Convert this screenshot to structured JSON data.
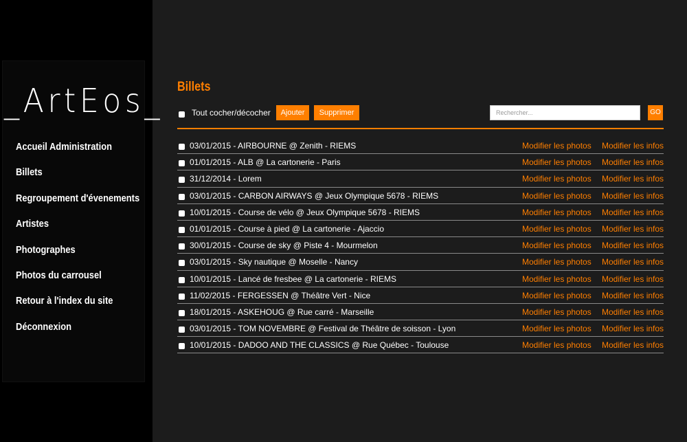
{
  "app": {
    "logo": "_ArtEos_",
    "accent_color": "#ff7f00"
  },
  "sidebar": {
    "items": [
      {
        "label": "Accueil Administration"
      },
      {
        "label": "Billets"
      },
      {
        "label": "Regroupement d'évenements"
      },
      {
        "label": "Artistes"
      },
      {
        "label": "Photographes"
      },
      {
        "label": "Photos du carrousel"
      },
      {
        "label": "Retour à l'index du site"
      },
      {
        "label": "Déconnexion"
      }
    ]
  },
  "main": {
    "title": "Billets",
    "toolbar": {
      "toggle_all_label": "Tout cocher/décocher",
      "add_label": "Ajouter",
      "delete_label": "Supprimer",
      "search_placeholder": "Rechercher...",
      "go_label": "GO"
    },
    "rows": [
      {
        "title": "03/01/2015 - AIRBOURNE @ Zenith - RIEMS",
        "photos": "Modifier les photos",
        "infos": "Modifier les infos"
      },
      {
        "title": "01/01/2015 - ALB @ La cartonerie - Paris",
        "photos": "Modifier les photos",
        "infos": "Modifier les infos"
      },
      {
        "title": "31/12/2014 - Lorem",
        "photos": "Modifier les photos",
        "infos": "Modifier les infos"
      },
      {
        "title": "03/01/2015 - CARBON AIRWAYS @ Jeux Olympique 5678 - RIEMS",
        "photos": "Modifier les photos",
        "infos": "Modifier les infos"
      },
      {
        "title": "10/01/2015 - Course de vélo @ Jeux Olympique 5678 - RIEMS",
        "photos": "Modifier les photos",
        "infos": "Modifier les infos"
      },
      {
        "title": "01/01/2015 - Course à pied @ La cartonerie - Ajaccio",
        "photos": "Modifier les photos",
        "infos": "Modifier les infos"
      },
      {
        "title": "30/01/2015 - Course de sky @ Piste 4 - Mourmelon",
        "photos": "Modifier les photos",
        "infos": "Modifier les infos"
      },
      {
        "title": "03/01/2015 - Sky nautique @ Moselle - Nancy",
        "photos": "Modifier les photos",
        "infos": "Modifier les infos"
      },
      {
        "title": "10/01/2015 - Lancé de fresbee @ La cartonerie - RIEMS",
        "photos": "Modifier les photos",
        "infos": "Modifier les infos"
      },
      {
        "title": "11/02/2015 - FERGESSEN @ Théâtre Vert - Nice",
        "photos": "Modifier les photos",
        "infos": "Modifier les infos"
      },
      {
        "title": "18/01/2015 - ASKEHOUG @ Rue carré - Marseille",
        "photos": "Modifier les photos",
        "infos": "Modifier les infos"
      },
      {
        "title": "03/01/2015 - TOM NOVEMBRE @ Festival de Théâtre de soisson - Lyon",
        "photos": "Modifier les photos",
        "infos": "Modifier les infos"
      },
      {
        "title": "10/01/2015 - DADOO AND THE CLASSICS @ Rue Québec - Toulouse",
        "photos": "Modifier les photos",
        "infos": "Modifier les infos"
      }
    ]
  }
}
